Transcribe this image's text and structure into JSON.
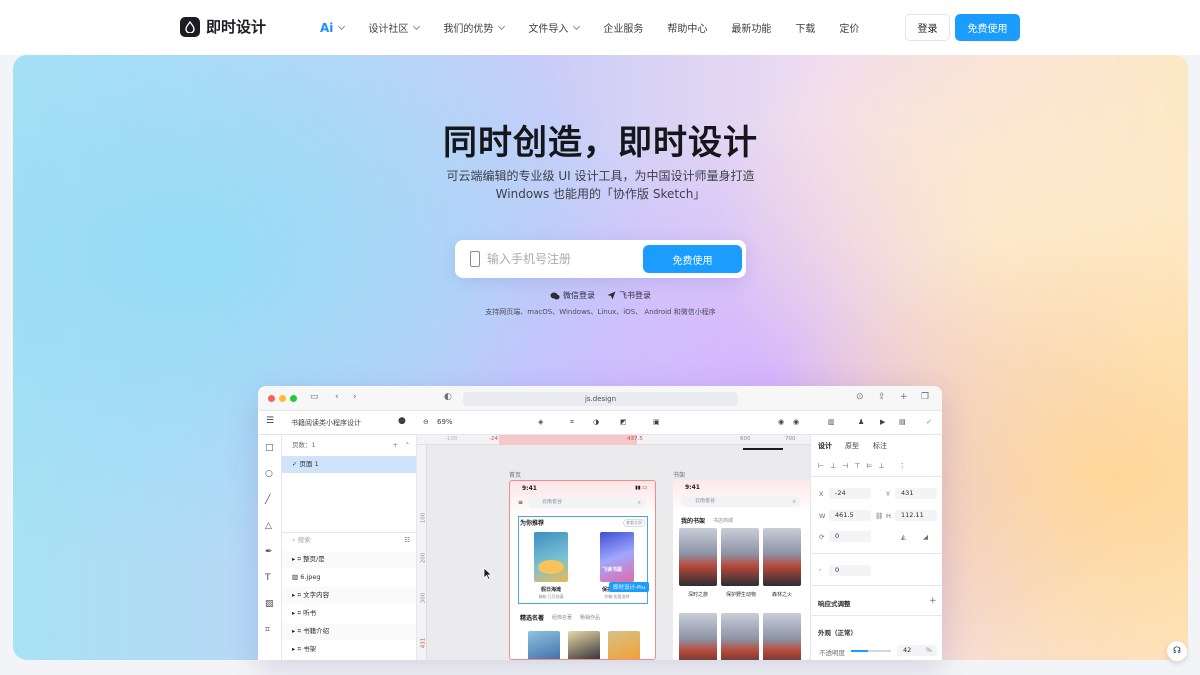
{
  "brand": {
    "name": "即时设计"
  },
  "nav": {
    "items": [
      {
        "label": "Ai",
        "dropdown": true
      },
      {
        "label": "设计社区",
        "dropdown": true
      },
      {
        "label": "我们的优势",
        "dropdown": true
      },
      {
        "label": "文件导入",
        "dropdown": true
      },
      {
        "label": "企业服务",
        "dropdown": false
      },
      {
        "label": "帮助中心",
        "dropdown": false
      },
      {
        "label": "最新功能",
        "dropdown": false
      },
      {
        "label": "下载",
        "dropdown": false
      },
      {
        "label": "定价",
        "dropdown": false
      }
    ],
    "login_label": "登录",
    "free_label": "免费使用"
  },
  "hero": {
    "title": "同时创造，即时设计",
    "subtitle_line1": "可云端编辑的专业级 UI 设计工具，为中国设计师量身打造",
    "subtitle_line2": "Windows 也能用的「协作版 Sketch」",
    "phone_placeholder": "输入手机号注册",
    "signup_button": "免费使用",
    "wechat_login": "微信登录",
    "feishu_login": "飞书登录",
    "platforms": "支持网页端、macOS、Windows、Linux、iOS、 Android 和微信小程序"
  },
  "app": {
    "url": "js.design",
    "file_name": "书籍阅读类小程序设计",
    "zoom": "69%",
    "pages_header": "页数：1",
    "page_item": "页面 1",
    "search_placeholder": "搜索",
    "layers": [
      "整页/是",
      "6.jpeg",
      "文字内容",
      "听书",
      "书籍介绍",
      "书架"
    ],
    "ruler_marks": [
      "-24",
      "437.5",
      "600",
      "700"
    ],
    "ruler_vmarks": [
      "100",
      "200",
      "300",
      "431"
    ],
    "frame1_label": "首页",
    "frame2_label": "书架",
    "phone_time": "9:41",
    "search_text_1": "云南雀谷",
    "search_text_2": "云南雀谷",
    "section_recommend": "为你推荐",
    "more_label": "查看全部",
    "book1_title": "假日海滩",
    "book1_sub": "佛勒·乃月前著",
    "book2_title": "保护野生动物",
    "book2_sub": "约翰·佐夏洛特",
    "book2_cover_text": "飞读书屋",
    "selection_label": "即时设计-Piu",
    "section_featured": "精选名著",
    "featured_tab1": "经典名著",
    "featured_tab2": "畅销作品",
    "shelf_title": "我的书架",
    "shelf_tab": "书店商城",
    "shelf_books": [
      "深时之旅",
      "保护野生动物",
      "森林之火"
    ],
    "props_tabs": [
      "设计",
      "原型",
      "标注"
    ],
    "x_label": "X",
    "x_value": "-24",
    "y_label": "Y",
    "y_value": "431",
    "w_label": "W",
    "w_value": "461.5",
    "h_label": "H",
    "h_value": "112.11",
    "rotation_value": "0",
    "radius_value": "0",
    "responsive_label": "响应式调整",
    "appearance_label": "外观（正常）",
    "opacity_label": "不透明度",
    "opacity_value": "42",
    "opacity_unit": "%"
  },
  "colors": {
    "accent": "#1a9dff",
    "dark": "#1c1d22"
  }
}
